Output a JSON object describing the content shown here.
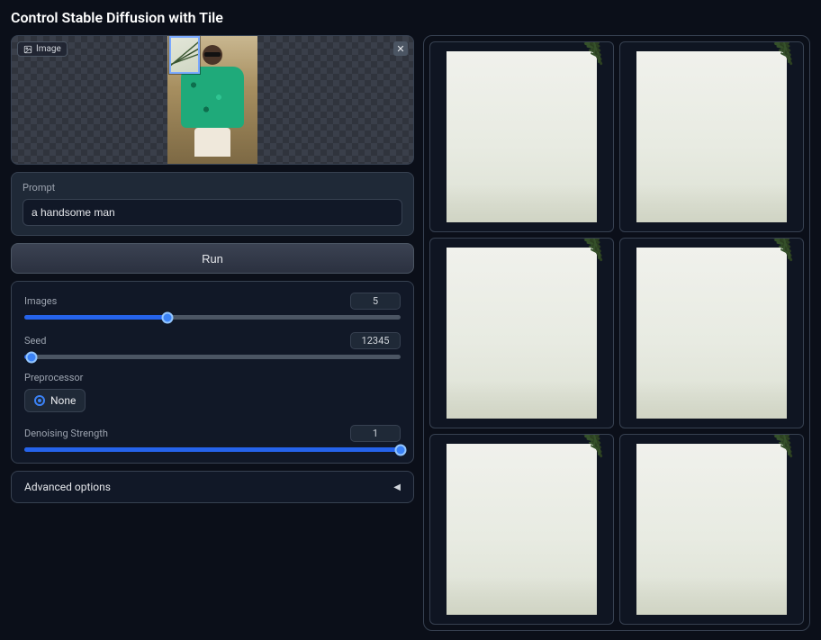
{
  "title": "Control Stable Diffusion with Tile",
  "image_panel": {
    "header_label": "Image"
  },
  "prompt": {
    "label": "Prompt",
    "value": "a handsome man"
  },
  "run_label": "Run",
  "sliders": {
    "images": {
      "label": "Images",
      "value": 5,
      "min": 0,
      "max": 12,
      "fill_pct": 38
    },
    "seed": {
      "label": "Seed",
      "value": 12345,
      "min": 0,
      "max": 999999,
      "fill_pct": 2
    },
    "denoise": {
      "label": "Denoising Strength",
      "value": 1,
      "min": 0,
      "max": 1,
      "fill_pct": 100
    }
  },
  "preprocessor": {
    "label": "Preprocessor",
    "options": [
      "None"
    ],
    "selected": "None"
  },
  "advanced": {
    "label": "Advanced options"
  },
  "gallery": {
    "count": 6
  }
}
